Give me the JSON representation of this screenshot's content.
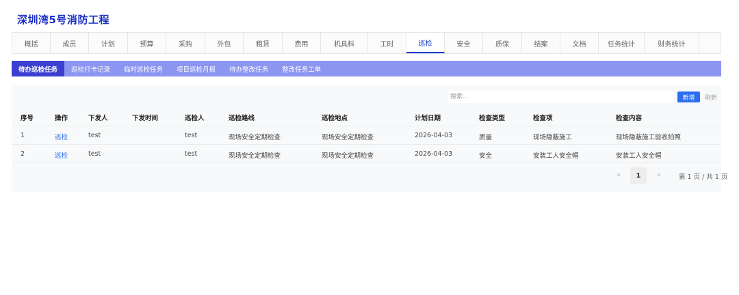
{
  "page_title": "深圳湾5号消防工程",
  "main_tabs": [
    "概括",
    "成员",
    "计划",
    "预算",
    "采购",
    "外包",
    "租赁",
    "费用",
    "机具料",
    "工时",
    "巡检",
    "安全",
    "质保",
    "结案",
    "文档",
    "任务统计",
    "财务统计"
  ],
  "main_tab_active": "巡检",
  "sub_tabs": [
    "待办巡检任务",
    "巡检打卡记录",
    "临时巡检任务",
    "项目巡检月报",
    "待办整改任务",
    "整改任务工单"
  ],
  "sub_tab_active": "待办巡检任务",
  "toolbar": {
    "search_placeholder": "搜索...",
    "add_label": "新增",
    "refresh_label": "刷新"
  },
  "table": {
    "headers": [
      "序号",
      "操作",
      "下发人",
      "下发时间",
      "巡检人",
      "巡检路线",
      "巡检地点",
      "计划日期",
      "检查类型",
      "检查项",
      "检查内容"
    ],
    "rows": [
      [
        "1",
        "巡检",
        "test",
        "",
        "test",
        "现场安全定期检查",
        "现场安全定期检查",
        "2026-04-03",
        "质量",
        "现场隐蔽施工",
        "现场隐蔽施工验收拍照"
      ],
      [
        "2",
        "巡检",
        "test",
        "",
        "test",
        "现场安全定期检查",
        "现场安全定期检查",
        "2026-04-03",
        "安全",
        "安装工人安全帽",
        "安装工人安全帽"
      ]
    ]
  },
  "pagination": {
    "prev": "«",
    "current": "1",
    "next": "»",
    "info": "第 1 页 / 共 1 页"
  },
  "colors": {
    "accent": "#2b6ef0",
    "title": "#1a2fc4",
    "subtab_bar": "#8c95f0",
    "subtab_active": "#3a3fd0"
  }
}
